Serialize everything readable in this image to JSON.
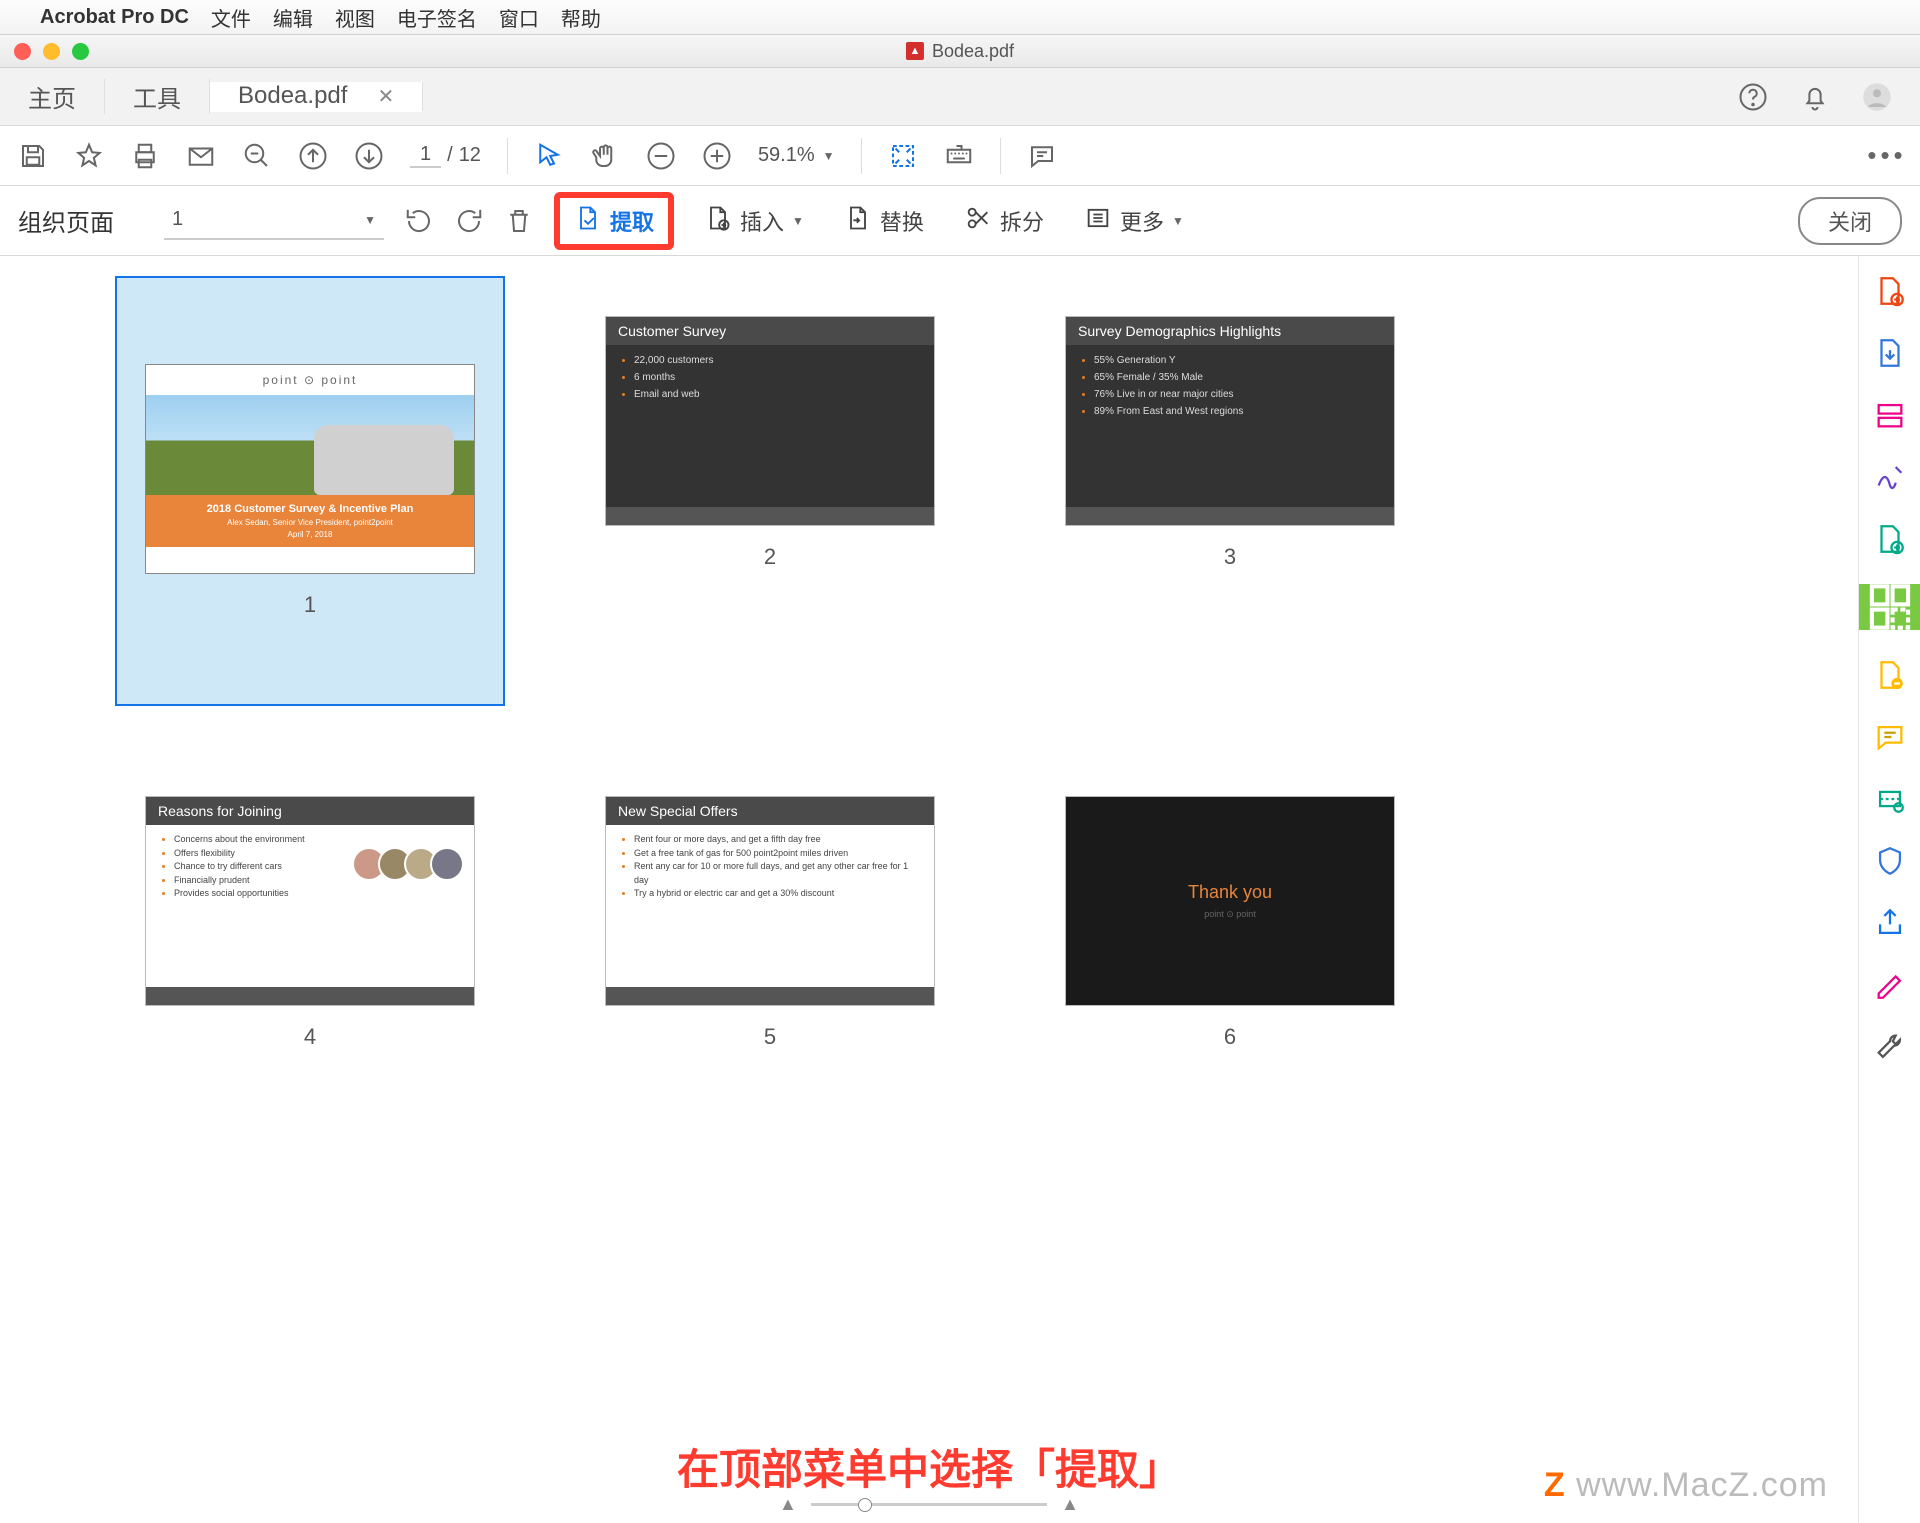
{
  "menubar": {
    "app_name": "Acrobat Pro DC",
    "items": [
      "文件",
      "编辑",
      "视图",
      "电子签名",
      "窗口",
      "帮助"
    ]
  },
  "window": {
    "title": "Bodea.pdf"
  },
  "tabs": {
    "home": "主页",
    "tools": "工具",
    "active": "Bodea.pdf"
  },
  "toolbar1": {
    "current_page": "1",
    "page_sep": "/",
    "total_pages": "12",
    "zoom": "59.1%"
  },
  "organize": {
    "title": "组织页面",
    "page_selector": "1",
    "extract": "提取",
    "insert": "插入",
    "replace": "替换",
    "split": "拆分",
    "more": "更多",
    "close": "关闭"
  },
  "pages": {
    "p1_num": "1",
    "p2_num": "2",
    "p3_num": "3",
    "p4_num": "4",
    "p5_num": "5",
    "p6_num": "6",
    "p1": {
      "brand": "point ⊙ point",
      "title": "2018 Customer Survey & Incentive Plan",
      "subtitle": "Alex Sedan, Senior Vice President, point2point",
      "date": "April 7, 2018"
    },
    "p2": {
      "title": "Customer Survey",
      "b1": "22,000 customers",
      "b2": "6 months",
      "b3": "Email and web"
    },
    "p3": {
      "title": "Survey Demographics Highlights",
      "b1": "55% Generation Y",
      "b2": "65% Female / 35% Male",
      "b3": "76% Live in or near major cities",
      "b4": "89% From East and West regions"
    },
    "p4": {
      "title": "Reasons for Joining",
      "b1": "Concerns about the environment",
      "b2": "Offers flexibility",
      "b3": "Chance to try different cars",
      "b4": "Financially prudent",
      "b5": "Provides social opportunities"
    },
    "p5": {
      "title": "New Special Offers",
      "b1": "Rent four or more days, and get a fifth day free",
      "b2": "Get a free tank of gas for 500 point2point miles driven",
      "b3": "Rent any car for 10 or more full days, and get any other car free for 1 day",
      "b4": "Try a hybrid or electric car and get a 30% discount"
    },
    "p6": {
      "thank_you": "Thank you",
      "sub": "point ⊙ point"
    }
  },
  "caption": "在顶部菜单中选择「提取」",
  "watermark": "www.MacZ.com",
  "icons": {
    "save": "save-icon",
    "star": "star-icon",
    "print": "print-icon",
    "mail": "mail-icon",
    "zoom_out": "zoom-out-icon",
    "up": "arrow-up-icon",
    "down": "arrow-down-icon",
    "select": "selection-tool-icon",
    "hand": "hand-tool-icon",
    "minus": "minus-icon",
    "plus": "plus-icon",
    "fit": "fit-icon",
    "keyboard": "keyboard-icon",
    "sticky": "sticky-note-icon",
    "more": "more-icon",
    "rotl": "rotate-left-icon",
    "rotr": "rotate-right-icon",
    "trash": "trash-icon",
    "extract": "extract-page-icon",
    "insert": "insert-page-icon",
    "replace": "replace-page-icon",
    "split": "split-icon",
    "gear": "gear-list-icon",
    "help": "help-icon",
    "bell": "bell-icon",
    "user": "user-avatar-icon"
  }
}
